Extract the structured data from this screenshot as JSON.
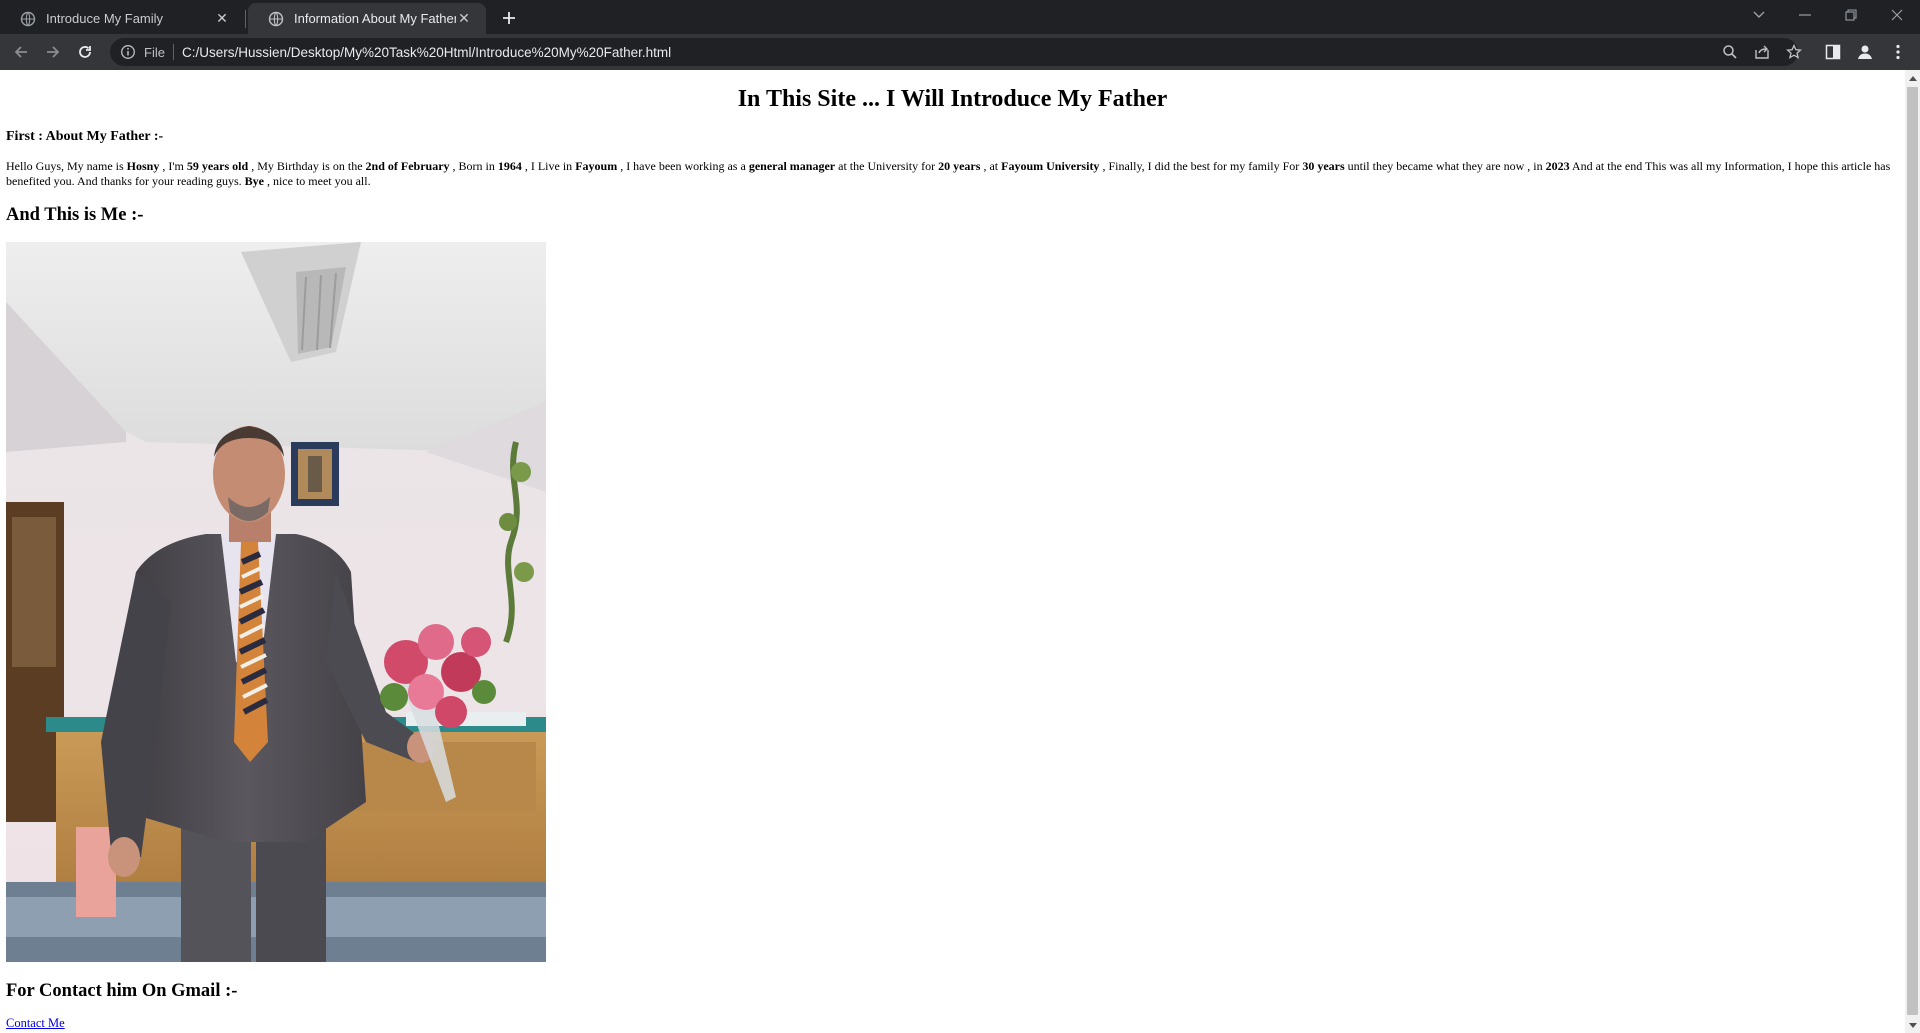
{
  "browser": {
    "tabs": [
      {
        "title": "Introduce My Family",
        "active": false
      },
      {
        "title": "Information About My Father",
        "active": true
      }
    ],
    "omnibox": {
      "scheme_label": "File",
      "url": "C:/Users/Hussien/Desktop/My%20Task%20Html/Introduce%20My%20Father.html"
    }
  },
  "page": {
    "title": "In This Site ... I Will Introduce My Father",
    "section_heading": "First : About My Father :-",
    "bio": {
      "t1": "Hello Guys, My name is ",
      "name": "Hosny",
      "t2": " , I'm ",
      "age": "59 years old",
      "t3": " , My Birthday is on the ",
      "birthday": "2nd of February",
      "t4": " , Born in ",
      "born": "1964",
      "t5": " , I Live in ",
      "city": "Fayoum",
      "t6": " , I have been working as a ",
      "job": "general manager",
      "t7": " at the University for ",
      "work_years": "20 years",
      "t8": " , at ",
      "university": "Fayoum University",
      "t9": " , Finally, I did the best for my family For ",
      "family_years": "30 years",
      "t10": " until they became what they are now , in ",
      "year": "2023",
      "t11": " And at the end This was all my Information, I hope this article has benefited you. And thanks for your reading guys. ",
      "bye": "Bye",
      "t12": " , nice to meet you all."
    },
    "me_heading": "And This is Me :-",
    "contact_heading": "For Contact him On Gmail :-",
    "contact_link": "Contact Me"
  },
  "colors": {
    "chrome_dark": "#202124",
    "chrome_toolbar": "#35363a",
    "link": "#0000ee"
  },
  "icons": [
    "globe-icon",
    "close-icon",
    "new-tab-icon",
    "back-icon",
    "forward-icon",
    "reload-icon",
    "info-icon",
    "zoom-icon",
    "share-icon",
    "star-icon",
    "side-panel-icon",
    "profile-icon",
    "menu-icon"
  ]
}
